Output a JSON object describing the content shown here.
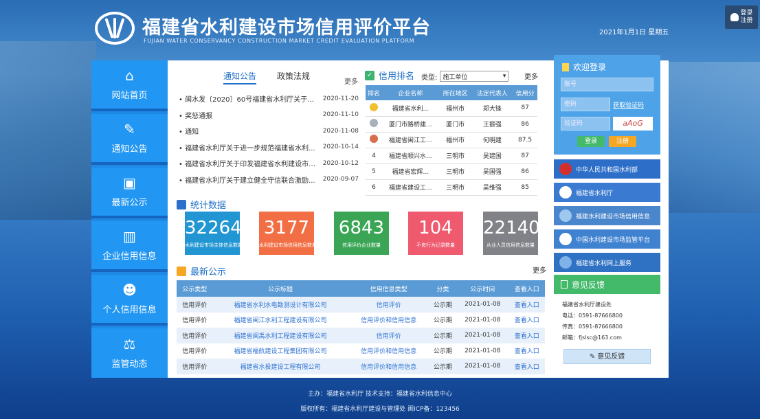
{
  "header": {
    "title": "福建省水利建设市场信用评价平台",
    "subtitle": "FUJIAN WATER CONSERVANCY CONSTRUCTION MARKET CREDIT EVALUATION PLATFORM",
    "date": "2021年1月1日 星期五",
    "user_label": "登录 注册"
  },
  "nav": [
    {
      "label": "网站首页",
      "icon": "home-icon"
    },
    {
      "label": "通知公告",
      "icon": "pen-icon"
    },
    {
      "label": "最新公示",
      "icon": "notice-icon"
    },
    {
      "label": "企业信用信息",
      "icon": "chart-icon"
    },
    {
      "label": "个人信用信息",
      "icon": "person-icon"
    },
    {
      "label": "监管动态",
      "icon": "gavel-icon"
    }
  ],
  "notices": {
    "tabs": [
      "通知公告",
      "政策法规"
    ],
    "more": "更多",
    "items": [
      {
        "title": "闽水发〔2020〕60号福建省水利厅关于...",
        "date": "2020-11-20"
      },
      {
        "title": "奖惩通报",
        "date": "2020-11-10"
      },
      {
        "title": "通知",
        "date": "2020-11-08"
      },
      {
        "title": "福建省水利厅关于进一步规范福建省水利...",
        "date": "2020-10-14"
      },
      {
        "title": "福建省水利厅关于印发福建省水利建设市场...",
        "date": "2020-10-12"
      },
      {
        "title": "福建省水利厅关于建立健全守信联合激励...",
        "date": "2020-09-07"
      }
    ]
  },
  "credit": {
    "title": "信用排名",
    "type_label": "类型:",
    "type_value": "施工单位",
    "more": "更多",
    "columns": [
      "排名",
      "企业名称",
      "所在地区",
      "法定代表人",
      "信用分"
    ],
    "rows": [
      {
        "rank": "1",
        "name": "福建省水利...",
        "region": "福州市",
        "rep": "郑大锋",
        "score": "87"
      },
      {
        "rank": "2",
        "name": "厦门市路桥建...",
        "region": "厦门市",
        "rep": "王振强",
        "score": "86"
      },
      {
        "rank": "3",
        "name": "福建省闽江工...",
        "region": "福州市",
        "rep": "何明建",
        "score": "87.5"
      },
      {
        "rank": "4",
        "name": "福建省顺兴水...",
        "region": "三明市",
        "rep": "吴建国",
        "score": "87"
      },
      {
        "rank": "5",
        "name": "福建省宏辉...",
        "region": "三明市",
        "rep": "吴国强",
        "score": "86"
      },
      {
        "rank": "6",
        "name": "福建省建设工...",
        "region": "三明市",
        "rep": "吴维强",
        "score": "85"
      }
    ]
  },
  "stats": {
    "title": "统计数据",
    "cards": [
      {
        "value": "32264",
        "label": "水利建设市场主体信息数量",
        "color": "#2196d3"
      },
      {
        "value": "3177",
        "label": "水利建设市场信用信息数量",
        "color": "#f26f45"
      },
      {
        "value": "6843",
        "label": "信用评价企业数量",
        "color": "#3aa655"
      },
      {
        "value": "104",
        "label": "不良行为记录数量",
        "color": "#ef5a6e"
      },
      {
        "value": "22140",
        "label": "从业人员信用信息数量",
        "color": "#808287"
      }
    ]
  },
  "bids": {
    "title": "最新公示",
    "more": "更多",
    "columns": [
      "公示类型",
      "公示标题",
      "信用信息类型",
      "分类",
      "公示时间",
      "查看入口"
    ],
    "rows": [
      {
        "type": "信用评价",
        "title": "福建省水利水电勘测设计有限公司",
        "info": "信用评价",
        "cat": "公示期",
        "time": "2021-01-08",
        "link": "查看入口"
      },
      {
        "type": "信用评价",
        "title": "福建省闽江水利工程建设有限公司",
        "info": "信用评价和信用信息",
        "cat": "公示期",
        "time": "2021-01-08",
        "link": "查看入口"
      },
      {
        "type": "信用评价",
        "title": "福建省闽禹水利工程建设有限公司",
        "info": "信用评价",
        "cat": "公示期",
        "time": "2021-01-08",
        "link": "查看入口"
      },
      {
        "type": "信用评价",
        "title": "福建省福航建设工程集团有限公司",
        "info": "信用评价和信用信息",
        "cat": "公示期",
        "time": "2021-01-08",
        "link": "查看入口"
      },
      {
        "type": "信用评价",
        "title": "福建省水投建设工程有限公司",
        "info": "信用评价和信用信息",
        "cat": "公示期",
        "time": "2021-01-08",
        "link": "查看入口"
      }
    ]
  },
  "login": {
    "title": "欢迎登录",
    "account_placeholder": "账号",
    "password_placeholder": "密码",
    "get_code": "获取验证码",
    "captcha_placeholder": "验证码",
    "captcha_text": "aAoG",
    "login_btn": "登录",
    "register_btn": "注册"
  },
  "banners": [
    {
      "label": "中华人民共和国水利部",
      "color": "#2d6ec9"
    },
    {
      "label": "福建省水利厅",
      "color": "#3a7bd1"
    },
    {
      "label": "福建水利建设市场信用信息",
      "color": "#4a86cc"
    },
    {
      "label": "中国水利建设市场监管平台",
      "color": "#3f82d0"
    },
    {
      "label": "福建省水利网上服务",
      "color": "#2f72c4"
    }
  ],
  "feedback": {
    "title": "意见反馈",
    "lines": [
      "福建省水利厅建设处",
      "电话：0591-87666800",
      "传真：0591-87666800",
      "邮箱：fjslsc@163.com"
    ],
    "button": "意见反馈"
  },
  "footer": {
    "line1": "主办：福建省水利厅  技术支持：福建省水利信息中心",
    "line2": "版权所有：福建省水利厅建设与管理处  闽ICP备：123456"
  }
}
